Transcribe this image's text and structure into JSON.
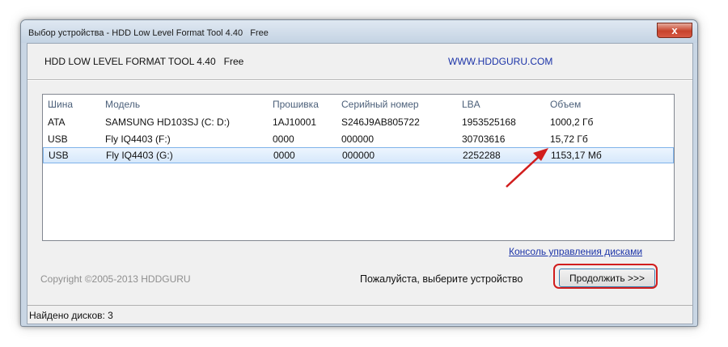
{
  "window": {
    "title": "Выбор устройства - HDD Low Level Format Tool 4.40   Free",
    "close_label": "x"
  },
  "header": {
    "app_title": "HDD LOW LEVEL FORMAT TOOL 4.40   Free",
    "site_link": "WWW.HDDGURU.COM"
  },
  "list": {
    "columns": [
      "Шина",
      "Модель",
      "Прошивка",
      "Серийный номер",
      "LBA",
      "Объем"
    ],
    "rows": [
      [
        "ATA",
        "SAMSUNG HD103SJ (C: D:)",
        "1AJ10001",
        "S246J9AB805722",
        "1953525168",
        "1000,2 Гб"
      ],
      [
        "USB",
        "Fly IQ4403 (F:)",
        "0000",
        "000000",
        "30703616",
        "15,72 Гб"
      ],
      [
        "USB",
        "Fly IQ4403 (G:)",
        "0000",
        "000000",
        "2252288",
        "1153,17 Мб"
      ]
    ],
    "selected_row": 2
  },
  "footer": {
    "console_link": "Консоль управления дисками",
    "copyright": "Copyright ©2005-2013 HDDGURU",
    "prompt": "Пожалуйста, выберите устройство",
    "continue_label": "Продолжить >>>"
  },
  "status": {
    "text": "Найдено дисков: 3"
  },
  "annotation_color": "#d11d1d"
}
